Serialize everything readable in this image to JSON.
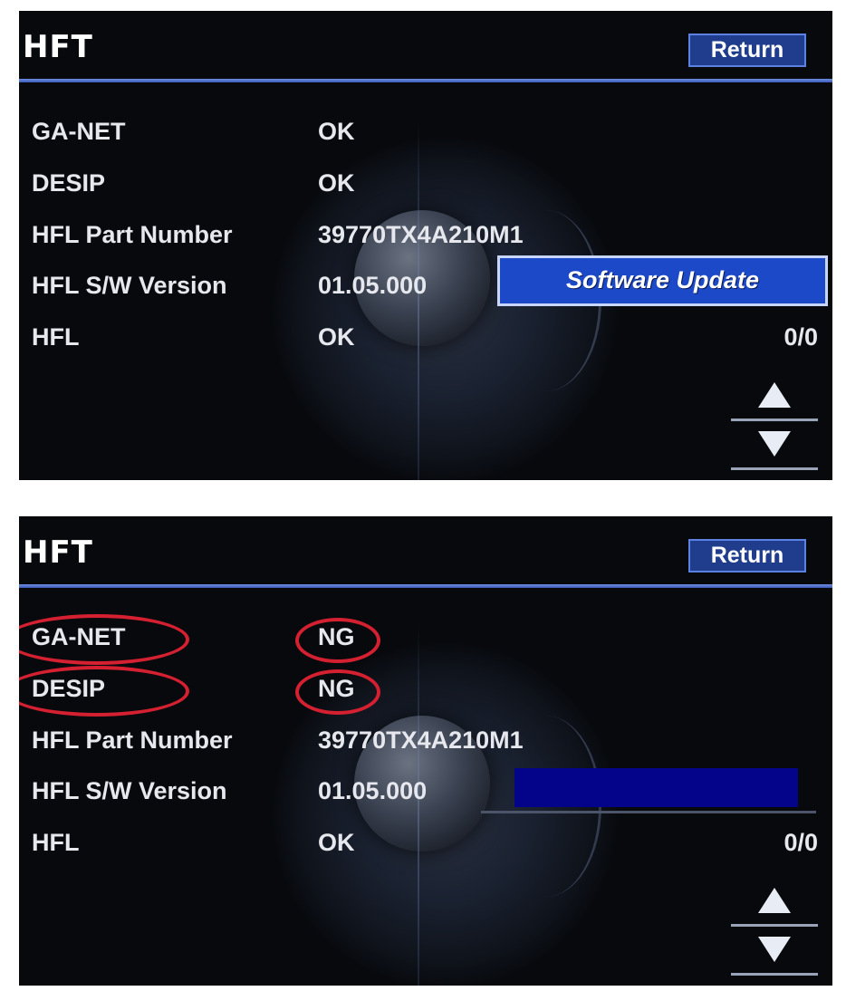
{
  "screens": [
    {
      "title": "HFT",
      "return_label": "Return",
      "rows": [
        {
          "label": "GA-NET",
          "value": "OK"
        },
        {
          "label": "DESIP",
          "value": "OK"
        },
        {
          "label": "HFL Part Number",
          "value": "39770TX4A210M1"
        },
        {
          "label": "HFL S/W Version",
          "value": "01.05.000"
        },
        {
          "label": "HFL",
          "value": "OK"
        }
      ],
      "software_update_label": "Software Update",
      "page_count": "0/0"
    },
    {
      "title": "HFT",
      "return_label": "Return",
      "rows": [
        {
          "label": "GA-NET",
          "value": "NG"
        },
        {
          "label": "DESIP",
          "value": "NG"
        },
        {
          "label": "HFL Part Number",
          "value": "39770TX4A210M1"
        },
        {
          "label": "HFL S/W Version",
          "value": "01.05.000"
        },
        {
          "label": "HFL",
          "value": "OK"
        }
      ],
      "page_count": "0/0"
    }
  ],
  "icons": {
    "scroll_up": "triangle-up-icon",
    "scroll_down": "triangle-down-icon"
  },
  "colors": {
    "highlight_ring": "#d42030",
    "button_blue": "#1c49c8",
    "bar_navy": "#03048a"
  }
}
